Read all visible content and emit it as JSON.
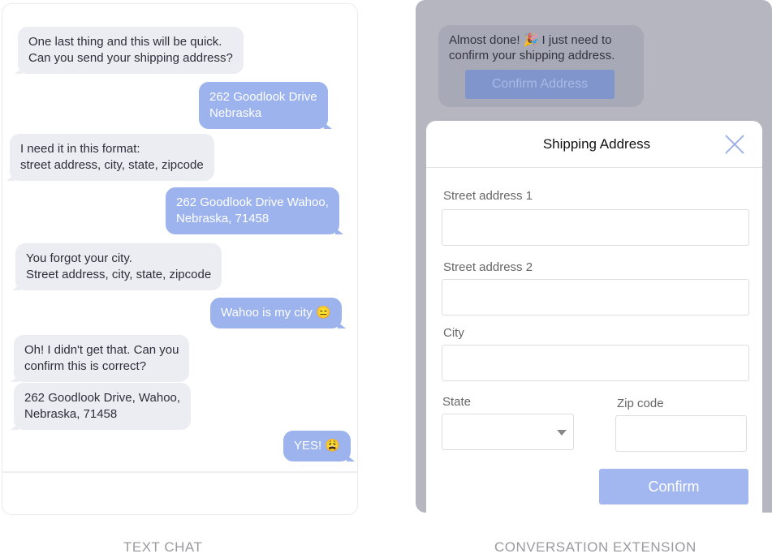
{
  "text_chat": {
    "caption": "TEXT CHAT",
    "messages": [
      {
        "from": "bot",
        "text": "One last thing and this will be quick.\nCan you send your shipping address?"
      },
      {
        "from": "user",
        "text": "262 Goodlook Drive\nNebraska"
      },
      {
        "from": "bot",
        "text": "I need it in this format:\nstreet address, city, state, zipcode"
      },
      {
        "from": "user",
        "text": "262 Goodlook Drive Wahoo,\nNebraska, 71458"
      },
      {
        "from": "bot",
        "text": "You forgot your city.\nStreet address, city, state, zipcode"
      },
      {
        "from": "user",
        "text": "Wahoo is my city 😑"
      },
      {
        "from": "bot",
        "text": "Oh! I didn't get that. Can you\nconfirm this is correct?"
      },
      {
        "from": "bot",
        "text": "262 Goodlook Drive, Wahoo,\nNebraska, 71458"
      },
      {
        "from": "user",
        "text": "YES! 😩"
      }
    ]
  },
  "extension": {
    "caption": "CONVERSATION EXTENSION",
    "bubble_text": "Almost done! 🎉 I just need to\nconfirm your shipping address.",
    "confirm_address_label": "Confirm Address",
    "modal": {
      "title": "Shipping Address",
      "close_icon": "close-icon",
      "street1_label": "Street address 1",
      "street1_value": "",
      "street2_label": "Street address 2",
      "street2_value": "",
      "city_label": "City",
      "city_value": "",
      "state_label": "State",
      "state_value": "",
      "zip_label": "Zip code",
      "zip_value": "",
      "confirm_label": "Confirm"
    }
  },
  "colors": {
    "user_bubble": "#9cb3ee",
    "bot_bubble": "#ececf3",
    "overlay": "#b5b6c0",
    "confirm": "#a2b7f0"
  }
}
